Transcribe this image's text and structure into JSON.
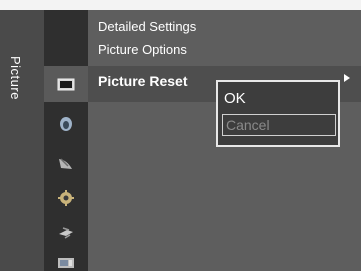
{
  "category": {
    "label": "Picture"
  },
  "icons": [
    {
      "name": "picture-icon",
      "color": "#cfcfcf"
    },
    {
      "name": "sound-icon",
      "color": "#9fb3c9"
    },
    {
      "name": "channel-icon",
      "color": "#a9a9a9"
    },
    {
      "name": "setup-icon",
      "color": "#c9b37a"
    },
    {
      "name": "input-icon",
      "color": "#c7c7c7"
    },
    {
      "name": "application-icon",
      "color": "#c9c9c9"
    }
  ],
  "menu": {
    "items": [
      {
        "label": "Detailed Settings"
      },
      {
        "label": "Picture Options"
      },
      {
        "label": "Picture Reset",
        "selected": true
      }
    ]
  },
  "popup": {
    "options": [
      {
        "label": "OK"
      },
      {
        "label": "Cancel",
        "focused": true
      }
    ]
  },
  "colors": {
    "panel": "#5e5e5e",
    "left_bar": "#4a4a4a",
    "icon_column": "#2f2f2f",
    "highlight": "#4e4e4e",
    "text": "#ffffff",
    "disabled_text": "#8a8a8a"
  }
}
